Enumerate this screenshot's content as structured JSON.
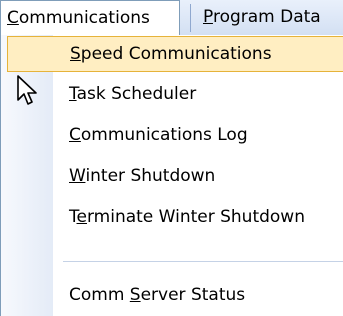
{
  "menubar": {
    "communications": {
      "pre": "",
      "key": "C",
      "post": "ommunications"
    },
    "program_data": {
      "pre": "",
      "key": "P",
      "post": "rogram Data"
    }
  },
  "dropdown": {
    "items": [
      {
        "pre": "",
        "key": "S",
        "post": "peed Communications",
        "highlighted": true
      },
      {
        "pre": "",
        "key": "T",
        "post": "ask Scheduler"
      },
      {
        "pre": "",
        "key": "C",
        "post": "ommunications Log"
      },
      {
        "pre": "",
        "key": "W",
        "post": "inter Shutdown"
      },
      {
        "pre": "T",
        "key": "e",
        "post": "rminate Winter Shutdown"
      },
      {
        "pre": "Comm ",
        "key": "S",
        "post": "erver Status"
      }
    ]
  },
  "colors": {
    "highlight_fill": "#ffeec2",
    "highlight_border": "#e6b33a",
    "menubar_top": "#e9f0fb",
    "menubar_bottom": "#d3e0f3"
  },
  "cursor": {
    "icon": "arrow-cursor-icon"
  }
}
